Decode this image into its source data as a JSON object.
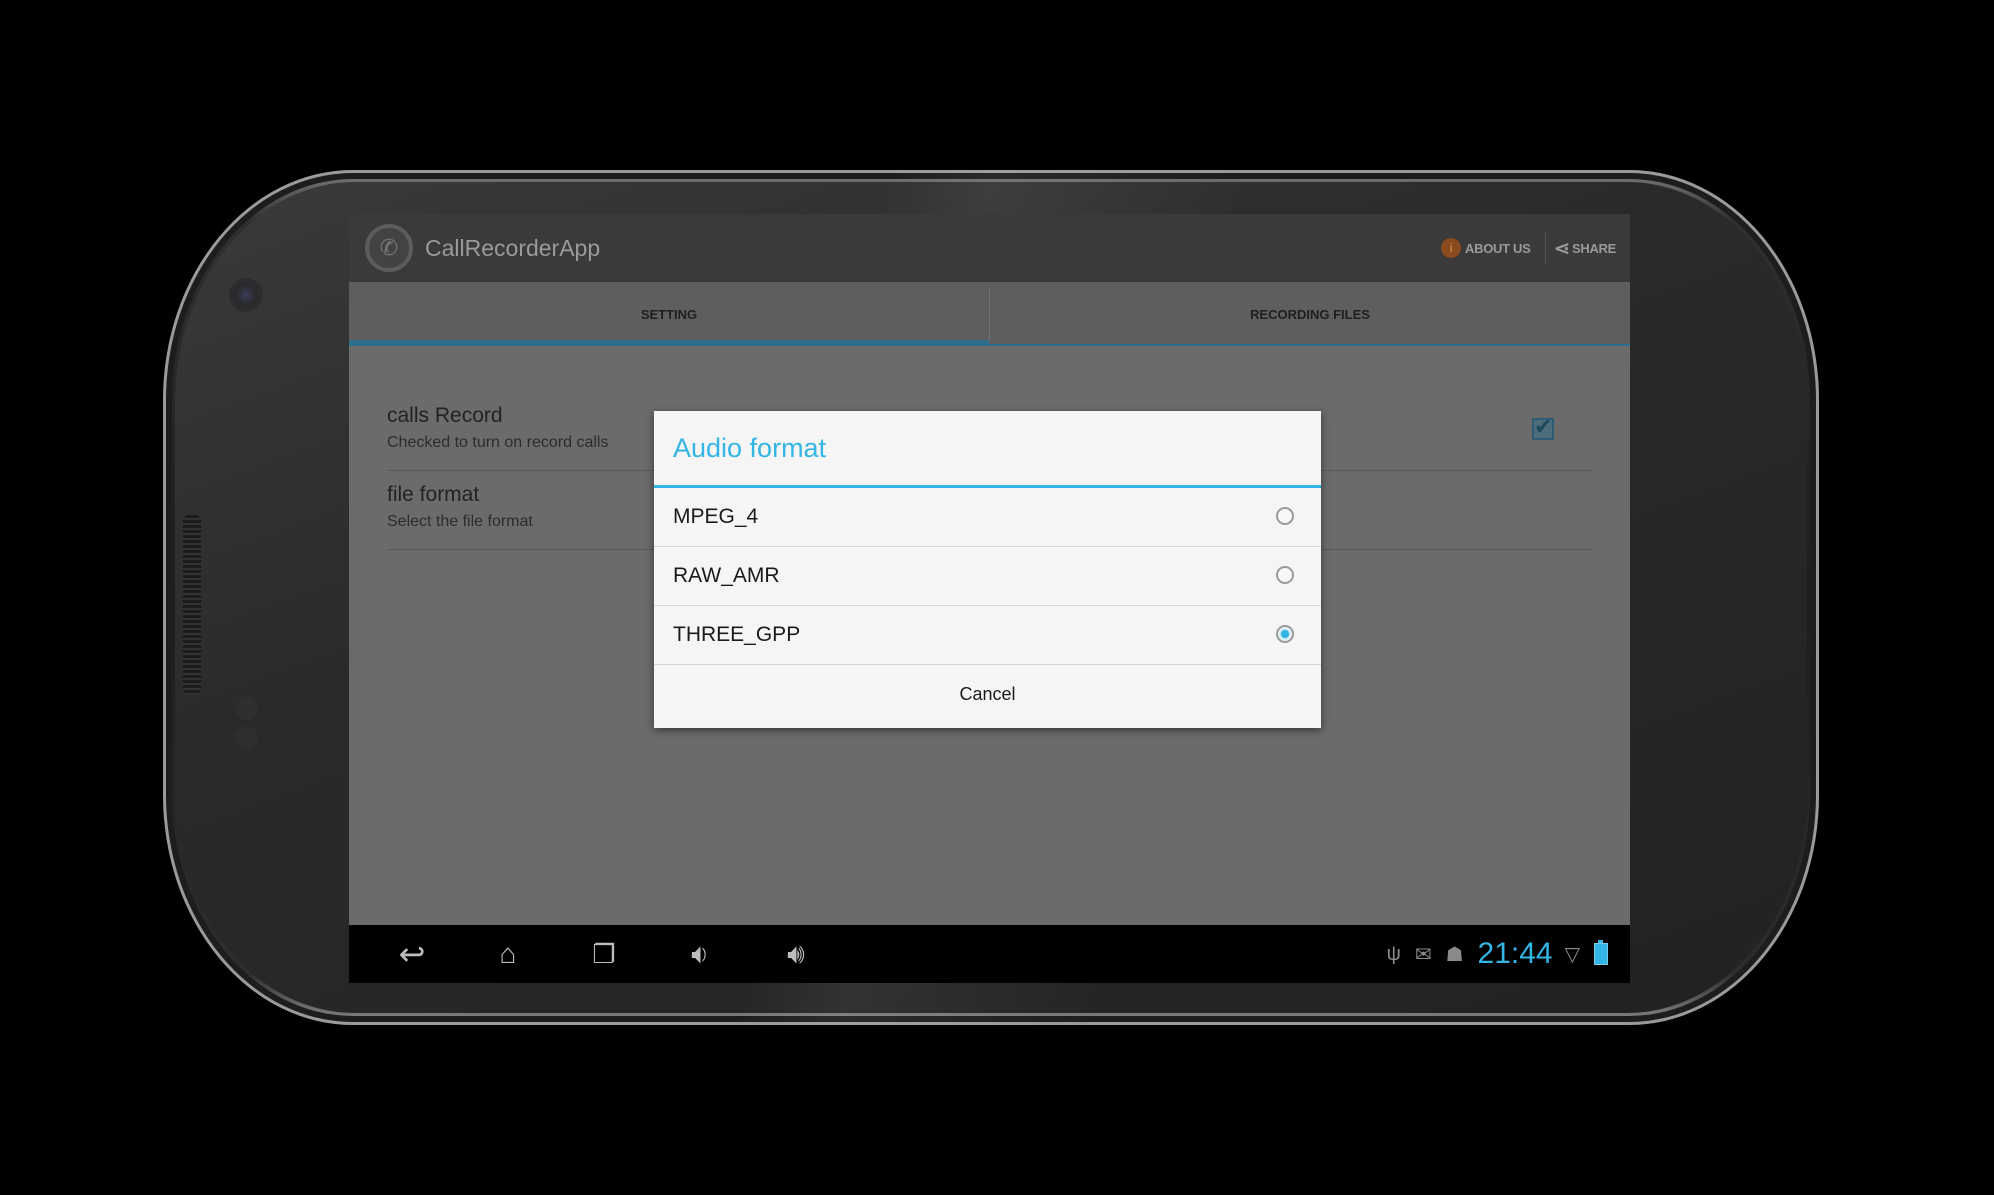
{
  "app": {
    "title": "CallRecorderApp",
    "about_label": "ABOUT US",
    "share_label": "SHARE"
  },
  "tabs": [
    {
      "label": "SETTING",
      "active": true
    },
    {
      "label": "RECORDING FILES",
      "active": false
    }
  ],
  "preferences": [
    {
      "title": "calls Record",
      "summary": "Checked to turn on record calls",
      "checked": true
    },
    {
      "title": "file format",
      "summary": "Select the file format"
    }
  ],
  "dialog": {
    "title": "Audio format",
    "options": [
      {
        "label": "MPEG_4",
        "selected": false
      },
      {
        "label": "RAW_AMR",
        "selected": false
      },
      {
        "label": "THREE_GPP",
        "selected": true
      }
    ],
    "cancel_label": "Cancel"
  },
  "system_bar": {
    "clock": "21:44",
    "nav_icons": [
      "back-icon",
      "home-icon",
      "recent-apps-icon",
      "volume-down-icon",
      "volume-up-icon"
    ],
    "status_icons": [
      "usb-icon",
      "gmail-icon",
      "android-debug-icon",
      "wifi-icon",
      "battery-icon"
    ]
  },
  "colors": {
    "accent": "#33b5e5",
    "tab_indicator": "#2e6f8e"
  }
}
